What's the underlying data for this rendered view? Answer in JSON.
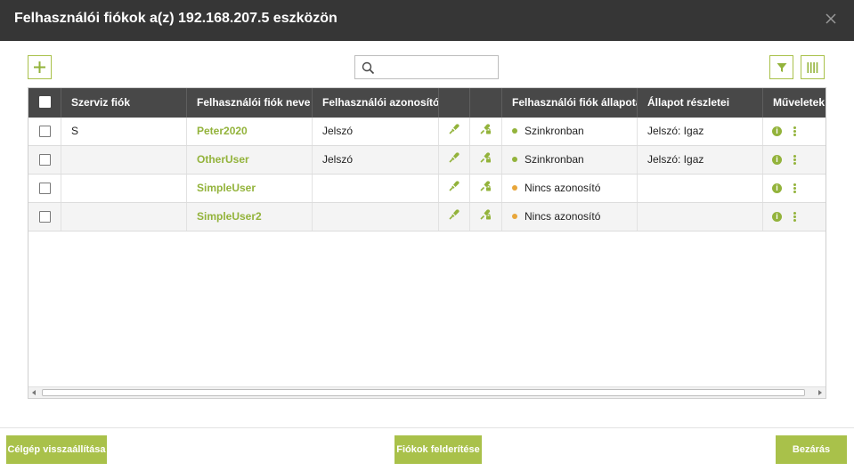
{
  "dialog": {
    "title": "Felhasználói fiókok a(z) 192.168.207.5 eszközön"
  },
  "toolbar": {
    "search_value": "",
    "search_placeholder": ""
  },
  "table": {
    "columns": [
      "",
      "Szerviz fiók",
      "Felhasználói fiók neve",
      "Felhasználói azonosítók",
      "",
      "",
      "Felhasználói fiók állapota",
      "Állapot részletei",
      "Műveletek"
    ],
    "rows": [
      {
        "service": "S",
        "name": "Peter2020",
        "credentials": "Jelszó",
        "status": "Szinkronban",
        "status_color": "#93b33b",
        "details": "Jelszó: Igaz"
      },
      {
        "service": "",
        "name": "OtherUser",
        "credentials": "Jelszó",
        "status": "Szinkronban",
        "status_color": "#93b33b",
        "details": "Jelszó: Igaz"
      },
      {
        "service": "",
        "name": "SimpleUser",
        "credentials": "",
        "status": "Nincs azonosító",
        "status_color": "#e8a63a",
        "details": ""
      },
      {
        "service": "",
        "name": "SimpleUser2",
        "credentials": "",
        "status": "Nincs azonosító",
        "status_color": "#e8a63a",
        "details": ""
      }
    ]
  },
  "icons": {
    "close": "close-icon",
    "add": "plus-icon",
    "search": "search-icon",
    "filter": "filter-icon",
    "columns": "columns-icon",
    "connect": "connect-icon",
    "connect_lock": "connect-lock-icon",
    "info": "info-icon",
    "more": "kebab-icon"
  },
  "colors": {
    "header_bg": "#363636",
    "accent": "#a9c14a",
    "link": "#93b33b",
    "status_ok": "#93b33b",
    "status_warn": "#e8a63a"
  },
  "footer": {
    "restore_label": "Célgép visszaállítása",
    "discover_label": "Fiókok felderítése",
    "close_label": "Bezárás"
  }
}
